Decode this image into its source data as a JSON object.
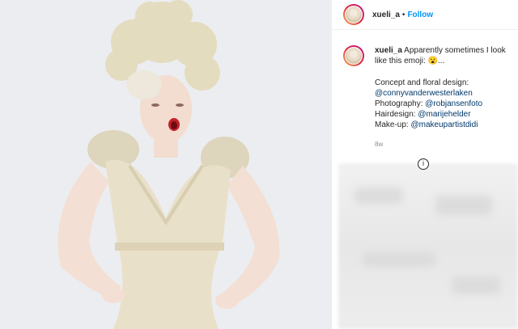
{
  "header": {
    "username": "xueli_a",
    "separator": "•",
    "follow_label": "Follow"
  },
  "caption": {
    "username": "xueli_a",
    "text": "Apparently sometimes I look like this emoji: 😮...",
    "concept_label": "Concept and floral design:",
    "concept_handle": "@connyvanderwesterlaken",
    "photo_label": "Photography:",
    "photo_handle": "@robjansenfoto",
    "hair_label": "Hairdesign:",
    "hair_handle": "@marijehelder",
    "makeup_label": "Make-up:",
    "makeup_handle": "@makeupartistdidi",
    "timestamp": "8w"
  },
  "icons": {
    "info": "info-icon"
  },
  "colors": {
    "link": "#00376b",
    "follow": "#0095f6",
    "text": "#262626",
    "muted": "#8e8e8e"
  }
}
